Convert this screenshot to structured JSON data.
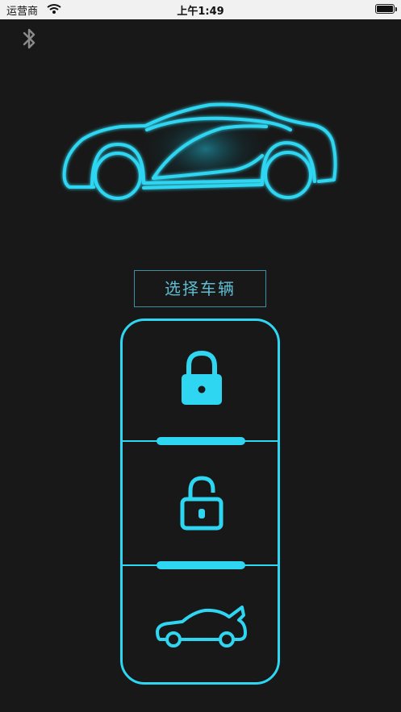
{
  "status_bar": {
    "carrier": "运营商",
    "time": "上午1:49",
    "icons": [
      "wifi-icon",
      "battery-icon"
    ]
  },
  "header": {
    "icons": [
      "bluetooth-icon"
    ]
  },
  "hero": {
    "icon": "car-outline-icon"
  },
  "select_vehicle": {
    "label": "选择车辆"
  },
  "key_fob": {
    "buttons": [
      {
        "icon": "lock-closed-icon"
      },
      {
        "icon": "lock-open-icon"
      },
      {
        "icon": "car-trunk-icon"
      }
    ]
  },
  "colors": {
    "accent": "#2fd6f2",
    "background": "#181818",
    "status_bar": "#f1f1f1",
    "label_text": "#5fbdd2",
    "bluetooth_icon": "#8a8a8a"
  }
}
